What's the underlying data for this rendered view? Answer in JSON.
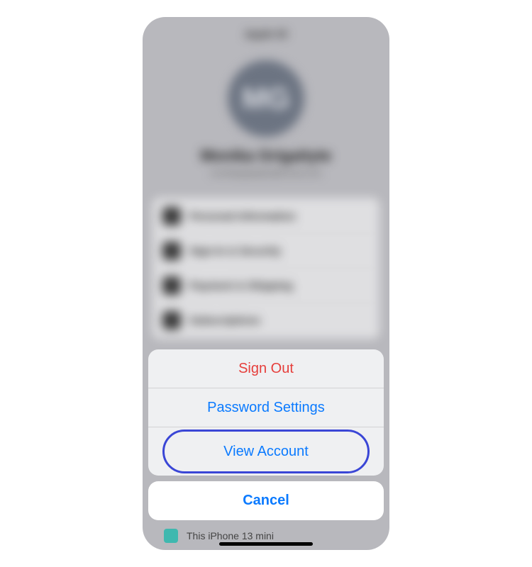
{
  "background": {
    "headerTitle": "Apple ID",
    "avatarInitials": "MG",
    "name": "Monika Grigaityte",
    "email": "monikagrigaityte@icloud.com",
    "rows": [
      {
        "label": "Personal Information"
      },
      {
        "label": "Sign-In & Security"
      },
      {
        "label": "Payment & Shipping"
      },
      {
        "label": "Subscriptions"
      }
    ]
  },
  "actionSheet": {
    "signOut": "Sign Out",
    "passwordSettings": "Password Settings",
    "viewAccount": "View Account",
    "cancel": "Cancel"
  },
  "peek": {
    "label": "This iPhone 13 mini"
  },
  "colors": {
    "accentBlue": "#0a7aff",
    "destructiveRed": "#e63e3b",
    "highlightRing": "#3a46d6"
  }
}
